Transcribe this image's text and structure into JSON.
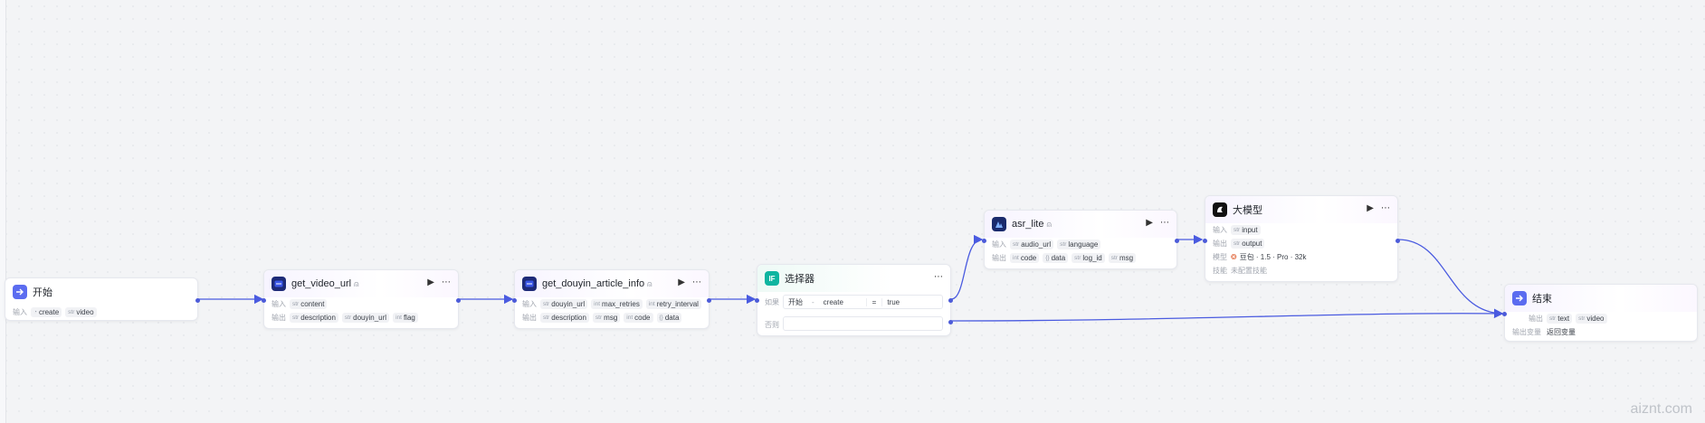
{
  "colors": {
    "accent": "#4c5bd9",
    "edge": "#4a5be0"
  },
  "nodes": {
    "start": {
      "title": "开始",
      "input_label": "输入",
      "inputs": [
        {
          "type": "bool",
          "name": "create"
        },
        {
          "type": "str",
          "name": "video"
        }
      ]
    },
    "get_video_url": {
      "title": "get_video_url",
      "input_label": "输入",
      "output_label": "输出",
      "inputs": [
        {
          "type": "str",
          "name": "content"
        }
      ],
      "outputs": [
        {
          "type": "str",
          "name": "description"
        },
        {
          "type": "str",
          "name": "douyin_url"
        },
        {
          "type": "int",
          "name": "flag"
        }
      ]
    },
    "get_douyin_article_info": {
      "title": "get_douyin_article_info",
      "input_label": "输入",
      "output_label": "输出",
      "inputs": [
        {
          "type": "str",
          "name": "douyin_url"
        },
        {
          "type": "int",
          "name": "max_retries"
        },
        {
          "type": "int",
          "name": "retry_interval"
        }
      ],
      "outputs": [
        {
          "type": "str",
          "name": "description"
        },
        {
          "type": "str",
          "name": "msg"
        },
        {
          "type": "int",
          "name": "code"
        },
        {
          "type": "{}",
          "name": "data"
        }
      ]
    },
    "selector": {
      "title": "选择器",
      "if_label": "如果",
      "else_label": "否则",
      "condition": {
        "left_node": "开始",
        "sep": "-",
        "left_var": "create",
        "op": "=",
        "right": "true"
      }
    },
    "asr_lite": {
      "title": "asr_lite",
      "input_label": "输入",
      "output_label": "输出",
      "inputs": [
        {
          "type": "str",
          "name": "audio_url"
        },
        {
          "type": "str",
          "name": "language"
        }
      ],
      "outputs": [
        {
          "type": "int",
          "name": "code"
        },
        {
          "type": "{}",
          "name": "data"
        },
        {
          "type": "str",
          "name": "log_id"
        },
        {
          "type": "str",
          "name": "msg"
        }
      ]
    },
    "llm": {
      "title": "大模型",
      "input_label": "输入",
      "output_label": "输出",
      "model_label": "模型",
      "skill_label": "技能",
      "inputs": [
        {
          "type": "str",
          "name": "input"
        }
      ],
      "outputs": [
        {
          "type": "str",
          "name": "output"
        }
      ],
      "model": "豆包 · 1.5 · Pro · 32k",
      "skill": "未配置技能"
    },
    "end": {
      "title": "结束",
      "output_label": "输出",
      "output_var_label": "输出变量",
      "outputs": [
        {
          "type": "str",
          "name": "text"
        },
        {
          "type": "str",
          "name": "video"
        }
      ],
      "return_label": "返回变量"
    }
  },
  "watermark": "aiznt.com"
}
